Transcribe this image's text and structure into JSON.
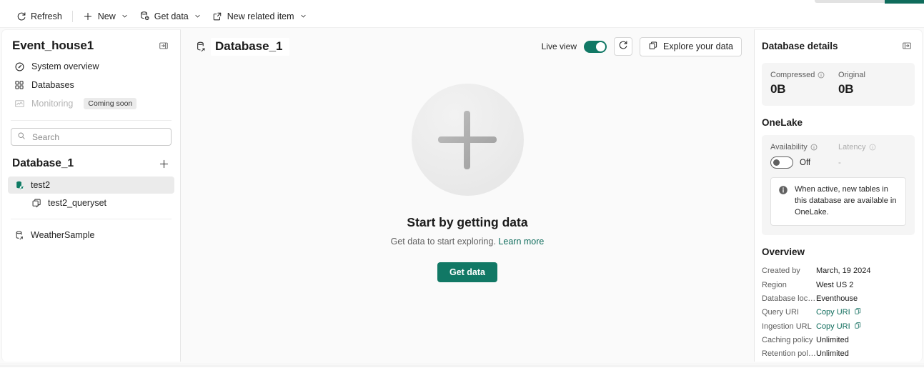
{
  "toolbar": {
    "items": [
      {
        "label": "Refresh",
        "icon": "refresh-icon",
        "chevron": false
      },
      {
        "label": "New",
        "icon": "plus-icon",
        "chevron": true
      },
      {
        "label": "Get data",
        "icon": "get-data-icon",
        "chevron": true
      },
      {
        "label": "New related item",
        "icon": "external-link-icon",
        "chevron": true
      }
    ]
  },
  "sidebar": {
    "title": "Event_house1",
    "collapse_icon": "collapse-panel-icon",
    "nav": [
      {
        "label": "System overview",
        "icon": "gauge-icon",
        "badge": "",
        "disabled": false
      },
      {
        "label": "Databases",
        "icon": "grid-icon",
        "badge": "",
        "disabled": false
      },
      {
        "label": "Monitoring",
        "icon": "monitor-icon",
        "badge": "Coming soon",
        "disabled": true
      }
    ],
    "search": {
      "placeholder": "Search",
      "value": "",
      "icon": "search-icon"
    },
    "database_header": {
      "title": "Database_1",
      "add_icon": "plus-icon"
    },
    "tree": [
      {
        "label": "test2",
        "icon": "table-icon",
        "selected": true,
        "indent": false
      },
      {
        "label": "test2_queryset",
        "icon": "queryset-icon",
        "selected": false,
        "indent": true
      }
    ],
    "tree_secondary": [
      {
        "label": "WeatherSample",
        "icon": "database-icon",
        "selected": false,
        "indent": false
      }
    ]
  },
  "center": {
    "title": "Database_1",
    "title_icon": "database-icon",
    "live_view_label": "Live view",
    "live_view_on": true,
    "refresh_icon": "refresh-icon",
    "explore_button": {
      "label": "Explore your data",
      "icon": "explore-icon"
    },
    "empty_state": {
      "plus_icon": "plus-icon",
      "title": "Start by getting data",
      "subtitle": "Get data to start exploring.",
      "link": "Learn more",
      "button": "Get data"
    }
  },
  "right_panel": {
    "title": "Database details",
    "expand_icon": "expand-panel-icon",
    "stats": [
      {
        "label": "Compressed",
        "value": "0B",
        "info": true,
        "muted": false
      },
      {
        "label": "Original",
        "value": "0B",
        "info": false,
        "muted": false
      }
    ],
    "onelake": {
      "section_title": "OneLake",
      "availability_label": "Availability",
      "availability_state": "Off",
      "availability_on": false,
      "latency_label": "Latency",
      "latency_value": "-",
      "note_icon": "info-icon",
      "note": "When active, new tables in this database are available in OneLake."
    },
    "overview": {
      "section_title": "Overview",
      "rows": [
        {
          "key": "Created by",
          "value": "March, 19 2024",
          "link": false,
          "copy": false
        },
        {
          "key": "Region",
          "value": "West US 2",
          "link": false,
          "copy": false
        },
        {
          "key": "Database locati...",
          "value": "Eventhouse",
          "link": false,
          "copy": false
        },
        {
          "key": "Query URI",
          "value": "Copy URI",
          "link": true,
          "copy": true
        },
        {
          "key": "Ingestion URL",
          "value": "Copy URI",
          "link": true,
          "copy": true
        },
        {
          "key": "Caching policy",
          "value": "Unlimited",
          "link": false,
          "copy": false
        },
        {
          "key": "Retention policy",
          "value": "Unlimited",
          "link": false,
          "copy": false
        }
      ]
    }
  },
  "colors": {
    "accent_teal": "#117865",
    "link_teal": "#0f6c5c",
    "panel_bg": "#fafafa",
    "selected_row": "#ebebeb"
  }
}
